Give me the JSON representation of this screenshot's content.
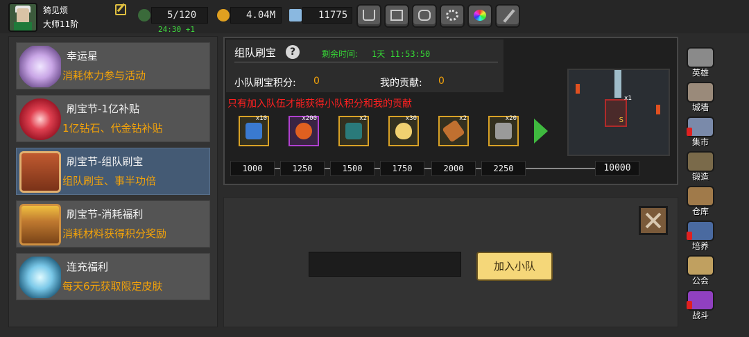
{
  "player": {
    "name": "猗见烦",
    "rank": "大师11阶"
  },
  "resources": {
    "energy": "5/120",
    "energy_timer": "24:30 +1",
    "gold": "4.04M",
    "gems": "11775"
  },
  "top_buttons": [
    "shop-cart-icon",
    "mail-icon",
    "gamepad-icon",
    "gear-icon",
    "color-wheel-icon",
    "sword-icon"
  ],
  "events": [
    {
      "title": "幸运星",
      "subtitle": "消耗体力参与活动",
      "icon": "star-icon"
    },
    {
      "title": "刷宝节-1亿补贴",
      "subtitle": "1亿钻石、代金钻补贴",
      "icon": "flower-icon"
    },
    {
      "title": "刷宝节-组队刷宝",
      "subtitle": "组队刷宝、事半功倍",
      "icon": "chest-icon",
      "active": true
    },
    {
      "title": "刷宝节-消耗福利",
      "subtitle": "消耗材料获得积分奖励",
      "icon": "open-chest-icon"
    },
    {
      "title": "连充福利",
      "subtitle": "每天6元获取限定皮肤",
      "icon": "crystal-icon"
    }
  ],
  "team": {
    "title": "组队刷宝",
    "remain_label": "剩余时间:",
    "remain_value": "1天 11:53:50",
    "score_label": "小队刷宝积分:",
    "score_value": "0",
    "contrib_label": "我的贡献:",
    "contrib_value": "0",
    "warning": "只有加入队伍才能获得小队积分和我的贡献"
  },
  "rewards": [
    {
      "count": "x10",
      "icon": "lightning-icon",
      "color": "#3a7ad0"
    },
    {
      "count": "x200",
      "icon": "fire-orb-icon",
      "color": "#e06020"
    },
    {
      "count": "x2",
      "icon": "book-icon",
      "color": "#2a7a7a"
    },
    {
      "count": "x30",
      "icon": "egg-icon",
      "color": "#f0d070"
    },
    {
      "count": "x2",
      "icon": "scroll-icon",
      "color": "#c07030"
    },
    {
      "count": "x20",
      "icon": "hammer-icon",
      "color": "#9a9a9a"
    }
  ],
  "milestones": [
    "1000",
    "1250",
    "1500",
    "1750",
    "2000",
    "2250",
    "10000"
  ],
  "scene": {
    "card_count": "x1",
    "card_letter": "S"
  },
  "join": {
    "input_value": "",
    "button_label": "加入小队"
  },
  "right_nav": [
    {
      "label": "英雄",
      "icon": "helmet-icon",
      "alert": false
    },
    {
      "label": "城墙",
      "icon": "wall-icon",
      "alert": false
    },
    {
      "label": "集市",
      "icon": "market-icon",
      "alert": true
    },
    {
      "label": "锻造",
      "icon": "anvil-icon",
      "alert": false
    },
    {
      "label": "仓库",
      "icon": "warehouse-icon",
      "alert": false
    },
    {
      "label": "培养",
      "icon": "goblet-icon",
      "alert": true
    },
    {
      "label": "公会",
      "icon": "guild-icon",
      "alert": false
    },
    {
      "label": "战斗",
      "icon": "portal-icon",
      "alert": true
    }
  ]
}
